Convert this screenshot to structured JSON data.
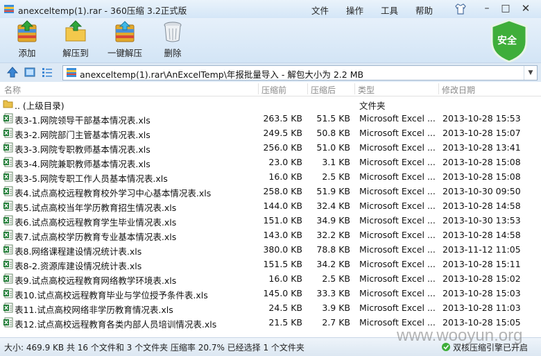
{
  "window": {
    "title": "anexceltemp(1).rar - 360压缩 3.2正式版",
    "menus": [
      "文件",
      "操作",
      "工具",
      "帮助"
    ]
  },
  "toolbar": {
    "add_label": "添加",
    "extract_label": "解压到",
    "oneclick_label": "一键解压",
    "delete_label": "删除",
    "security_label": "安全"
  },
  "address": {
    "path": "anexceltemp(1).rar\\AnExcelTemp\\年报批量导入 - 解包大小为 2.2 MB"
  },
  "columns": {
    "name": "名称",
    "size": "压缩前",
    "packed": "压缩后",
    "type": "类型",
    "modified": "修改日期"
  },
  "rows": [
    {
      "name": ".. (上级目录)",
      "size": "",
      "packed": "",
      "type": "文件夹",
      "date": "",
      "kind": "folder"
    },
    {
      "name": "表3-1.网院领导干部基本情况表.xls",
      "size": "263.5 KB",
      "packed": "51.5 KB",
      "type": "Microsoft Excel ...",
      "date": "2013-10-28 15:53",
      "kind": "xls"
    },
    {
      "name": "表3-2.网院部门主管基本情况表.xls",
      "size": "249.5 KB",
      "packed": "50.8 KB",
      "type": "Microsoft Excel ...",
      "date": "2013-10-28 15:07",
      "kind": "xls"
    },
    {
      "name": "表3-3.网院专职教师基本情况表.xls",
      "size": "256.0 KB",
      "packed": "51.0 KB",
      "type": "Microsoft Excel ...",
      "date": "2013-10-28 13:41",
      "kind": "xls"
    },
    {
      "name": "表3-4.网院兼职教师基本情况表.xls",
      "size": "23.0 KB",
      "packed": "3.1 KB",
      "type": "Microsoft Excel ...",
      "date": "2013-10-28 15:08",
      "kind": "xls"
    },
    {
      "name": "表3-5.网院专职工作人员基本情况表.xls",
      "size": "16.0 KB",
      "packed": "2.5 KB",
      "type": "Microsoft Excel ...",
      "date": "2013-10-28 15:08",
      "kind": "xls"
    },
    {
      "name": "表4.试点高校远程教育校外学习中心基本情况表.xls",
      "size": "258.0 KB",
      "packed": "51.9 KB",
      "type": "Microsoft Excel ...",
      "date": "2013-10-30 09:50",
      "kind": "xls"
    },
    {
      "name": "表5.试点高校当年学历教育招生情况表.xls",
      "size": "144.0 KB",
      "packed": "32.4 KB",
      "type": "Microsoft Excel ...",
      "date": "2013-10-28 14:58",
      "kind": "xls"
    },
    {
      "name": "表6.试点高校远程教育学生毕业情况表.xls",
      "size": "151.0 KB",
      "packed": "34.9 KB",
      "type": "Microsoft Excel ...",
      "date": "2013-10-30 13:53",
      "kind": "xls"
    },
    {
      "name": "表7.试点高校学历教育专业基本情况表.xls",
      "size": "143.0 KB",
      "packed": "32.2 KB",
      "type": "Microsoft Excel ...",
      "date": "2013-10-28 14:58",
      "kind": "xls"
    },
    {
      "name": "表8.网络课程建设情况统计表.xls",
      "size": "380.0 KB",
      "packed": "78.8 KB",
      "type": "Microsoft Excel ...",
      "date": "2013-11-12 11:05",
      "kind": "xls"
    },
    {
      "name": "表8-2.资源库建设情况统计表.xls",
      "size": "151.5 KB",
      "packed": "34.2 KB",
      "type": "Microsoft Excel ...",
      "date": "2013-10-28 15:11",
      "kind": "xls"
    },
    {
      "name": "表9.试点高校远程教育网络教学环境表.xls",
      "size": "16.0 KB",
      "packed": "2.5 KB",
      "type": "Microsoft Excel ...",
      "date": "2013-10-28 15:02",
      "kind": "xls"
    },
    {
      "name": "表10.试点高校远程教育毕业与学位授予条件表.xls",
      "size": "145.0 KB",
      "packed": "33.3 KB",
      "type": "Microsoft Excel ...",
      "date": "2013-10-28 15:03",
      "kind": "xls"
    },
    {
      "name": "表11.试点高校网络非学历教育情况表.xls",
      "size": "24.5 KB",
      "packed": "3.9 KB",
      "type": "Microsoft Excel ...",
      "date": "2013-10-28 11:03",
      "kind": "xls"
    },
    {
      "name": "表12.试点高校远程教育各类内部人员培训情况表.xls",
      "size": "21.5 KB",
      "packed": "2.7 KB",
      "type": "Microsoft Excel ...",
      "date": "2013-10-28 15:05",
      "kind": "xls"
    }
  ],
  "status": {
    "summary": "大小: 469.9 KB 共 16 个文件和 3 个文件夹 压缩率 20.7% 已经选择 1 个文件夹",
    "share": "双核压缩引擎已开启"
  },
  "watermark": "www.wooyun.org",
  "colors": {
    "titlebar": "#d4e6f7",
    "toolbar": "#d3e5f6",
    "shield": "#3fae3a",
    "excel_green": "#1e7b34",
    "folder_yellow": "#e9c04a"
  }
}
